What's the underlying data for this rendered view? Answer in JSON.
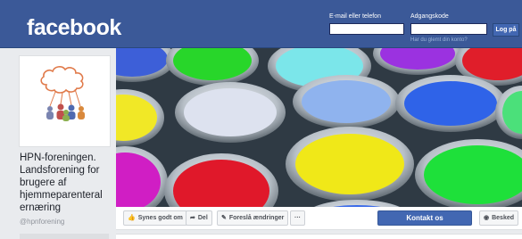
{
  "header": {
    "logo": "facebook",
    "email_label": "E-mail eller telefon",
    "password_label": "Adgangskode",
    "login_button": "Log på",
    "forgot_link": "Har du glemt din konto?"
  },
  "page": {
    "name_lines": [
      "HPN-foreningen.",
      "Landsforening for",
      "brugere af",
      "hjemmeparenteral",
      "ernæring"
    ],
    "handle": "@hpnforening"
  },
  "actions": {
    "like": "Synes godt om",
    "share": "Del",
    "suggest": "Foreslå ændringer",
    "more": "···",
    "contact": "Kontakt os",
    "message": "Besked"
  },
  "colors": {
    "brand": "#3b5998",
    "button_blue": "#4267b2"
  }
}
